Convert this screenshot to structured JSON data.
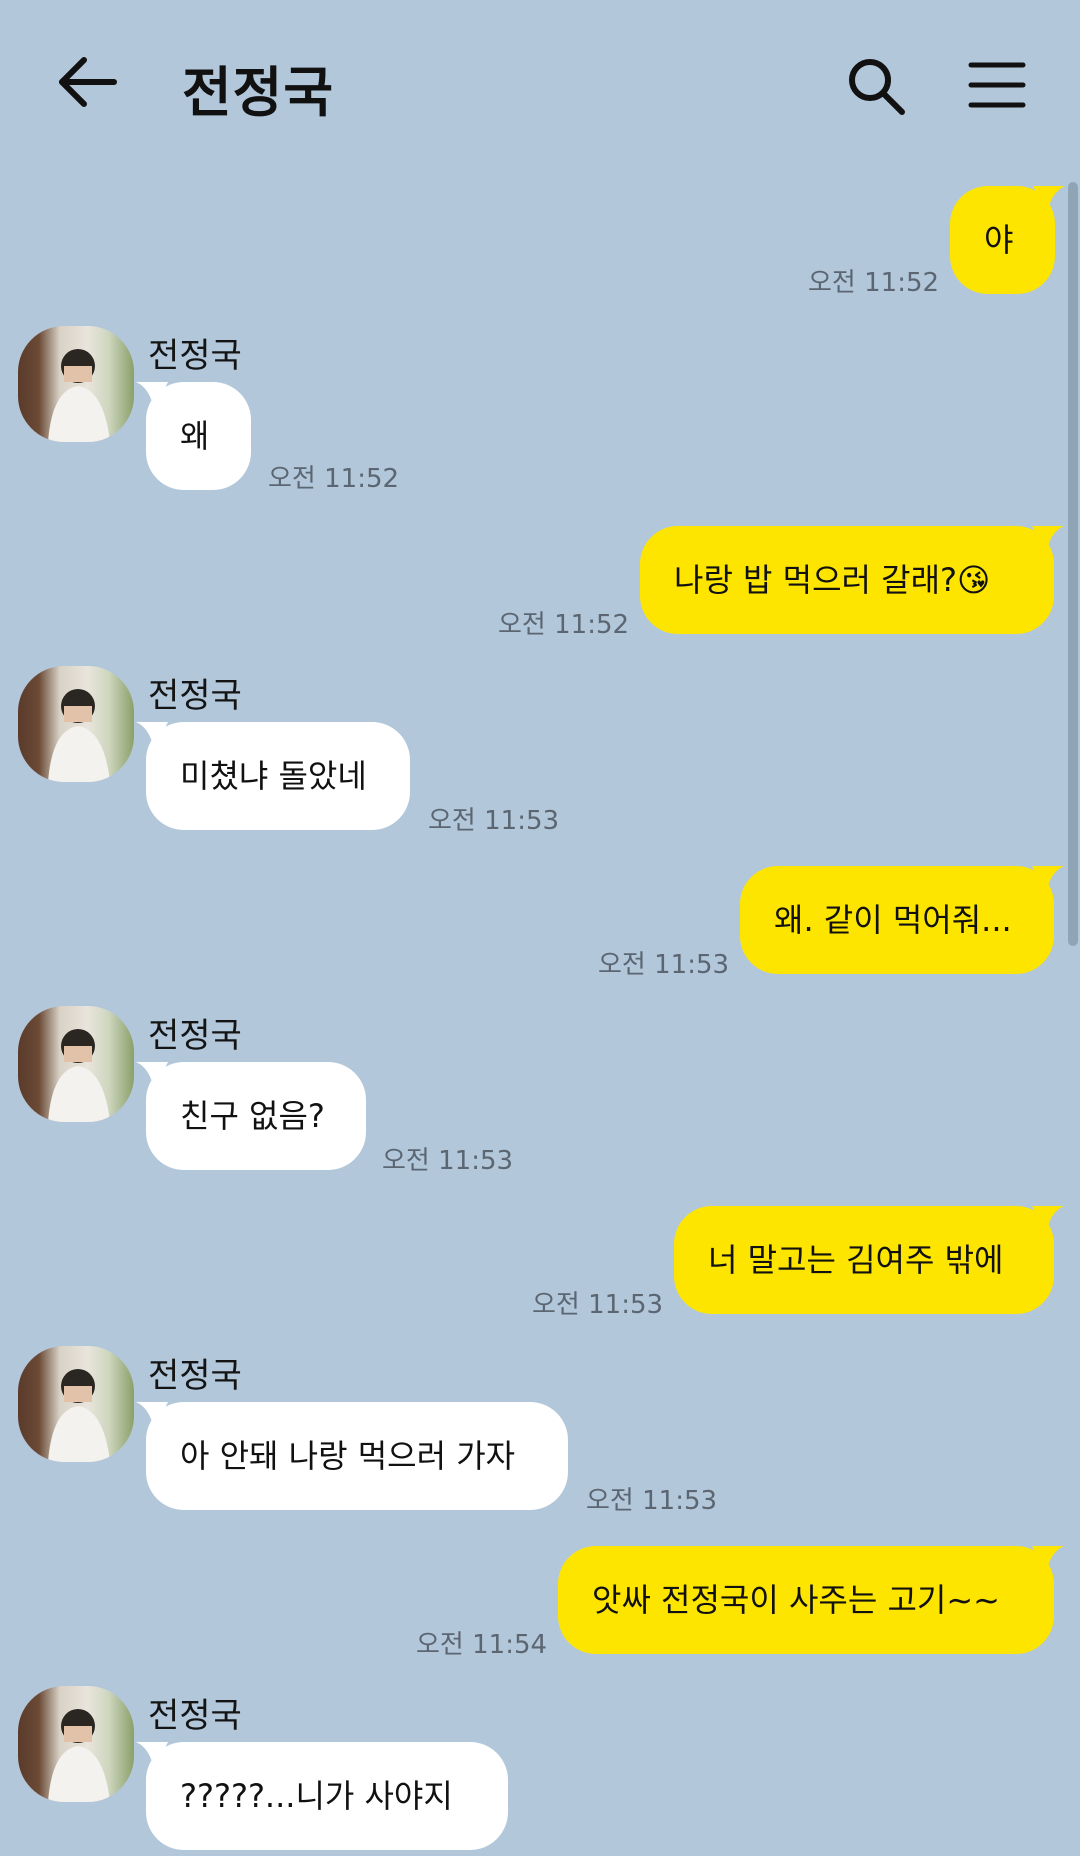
{
  "header": {
    "title": "전정국",
    "back_icon": "arrow-left-icon",
    "search_icon": "search-icon",
    "menu_icon": "hamburger-menu-icon"
  },
  "colors": {
    "background": "#b2c7da",
    "outgoing_bubble": "#fee500",
    "incoming_bubble": "#ffffff",
    "timestamp": "#5b6672"
  },
  "messages": [
    {
      "direction": "out",
      "text": "야",
      "time": "오전 11:52"
    },
    {
      "direction": "in",
      "sender": "전정국",
      "text": "왜",
      "time": "오전 11:52"
    },
    {
      "direction": "out",
      "text": "나랑 밥 먹으러 갈래?😘",
      "time": "오전 11:52"
    },
    {
      "direction": "in",
      "sender": "전정국",
      "text": "미쳤냐 돌았네",
      "time": "오전 11:53"
    },
    {
      "direction": "out",
      "text": "왜. 같이 먹어줘...",
      "time": "오전 11:53"
    },
    {
      "direction": "in",
      "sender": "전정국",
      "text": "친구 없음?",
      "time": "오전 11:53"
    },
    {
      "direction": "out",
      "text": "너 말고는 김여주 밖에",
      "time": "오전 11:53"
    },
    {
      "direction": "in",
      "sender": "전정국",
      "text": "아 안돼 나랑 먹으러 가자",
      "time": "오전 11:53"
    },
    {
      "direction": "out",
      "text": "앗싸 전정국이 사주는 고기~~",
      "time": "오전 11:54"
    },
    {
      "direction": "in",
      "sender": "전정국",
      "text": "?????...니가 사야지",
      "time": ""
    }
  ]
}
